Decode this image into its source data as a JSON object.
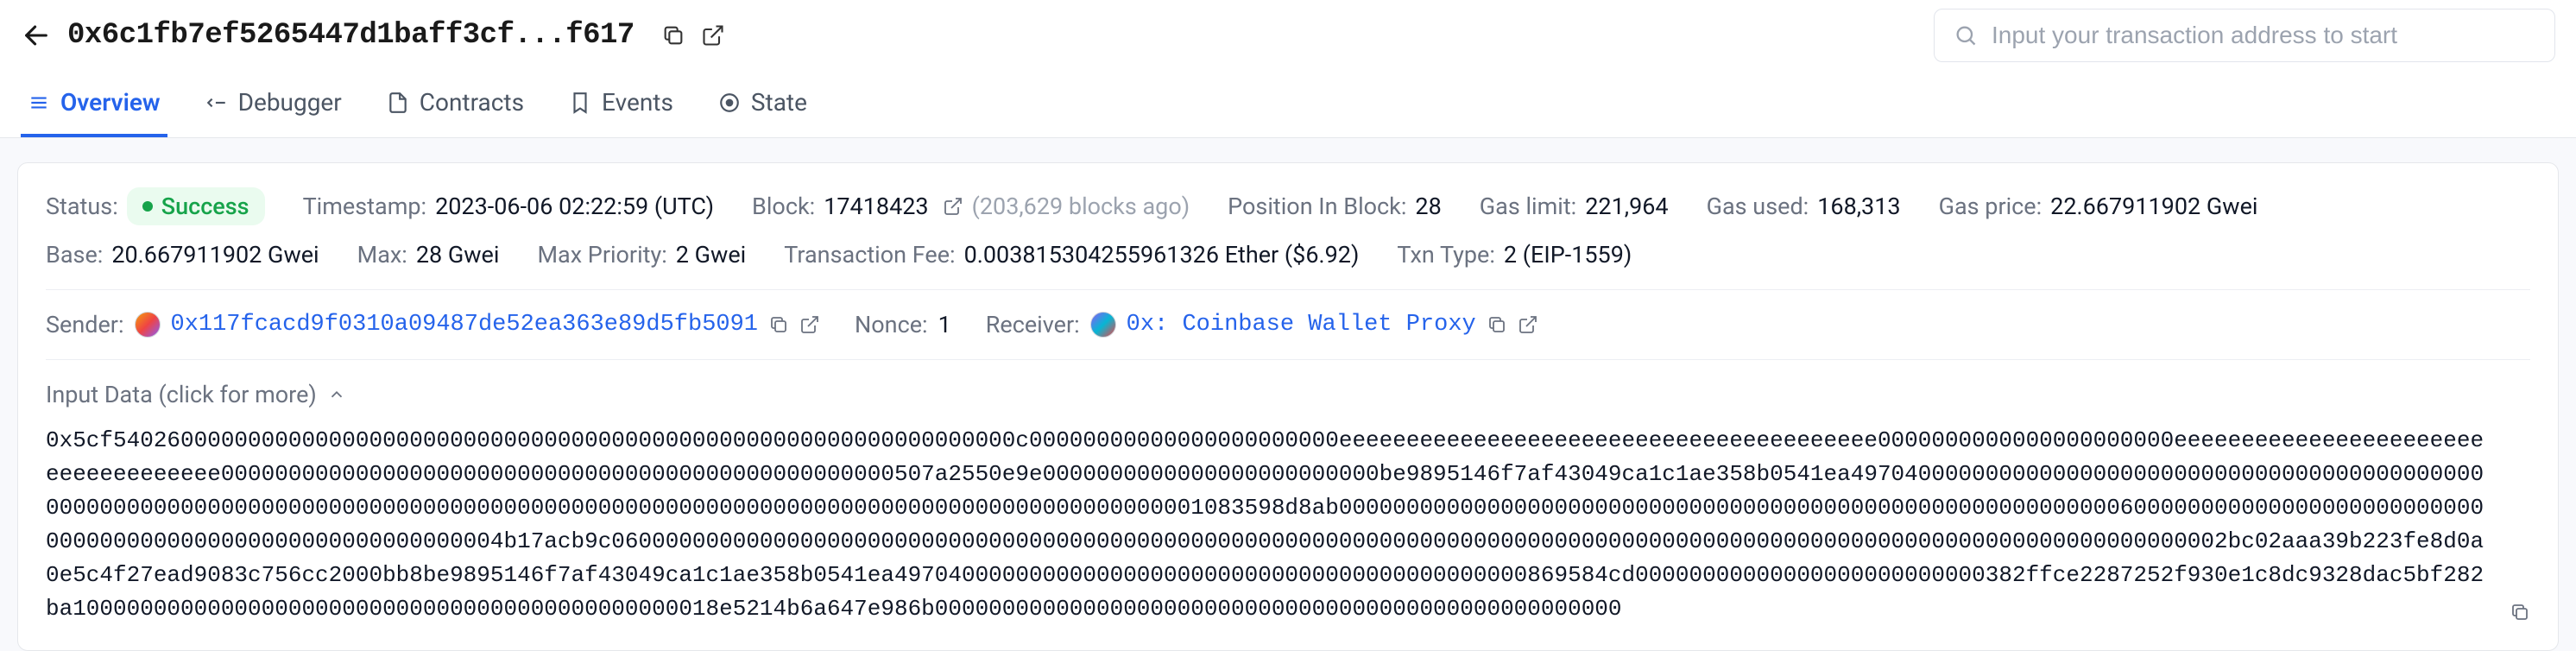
{
  "header": {
    "title": "0x6c1fb7ef5265447d1baff3cf...f617",
    "search_placeholder": "Input your transaction address to start"
  },
  "tabs": {
    "overview": "Overview",
    "debugger": "Debugger",
    "contracts": "Contracts",
    "events": "Events",
    "state": "State"
  },
  "meta": {
    "status_label": "Status:",
    "status_value": "Success",
    "timestamp_label": "Timestamp:",
    "timestamp_value": "2023-06-06 02:22:59 (UTC)",
    "block_label": "Block:",
    "block_value": "17418423",
    "blocks_ago": "(203,629 blocks ago)",
    "position_label": "Position In Block:",
    "position_value": "28",
    "gas_limit_label": "Gas limit:",
    "gas_limit_value": "221,964",
    "gas_used_label": "Gas used:",
    "gas_used_value": "168,313",
    "gas_price_label": "Gas price:",
    "gas_price_value": "22.667911902 Gwei",
    "base_label": "Base:",
    "base_value": "20.667911902 Gwei",
    "max_label": "Max:",
    "max_value": "28 Gwei",
    "max_priority_label": "Max Priority:",
    "max_priority_value": "2 Gwei",
    "txn_fee_label": "Transaction Fee:",
    "txn_fee_value": "0.003815304255961326 Ether ($6.92)",
    "txn_type_label": "Txn Type:",
    "txn_type_value": "2 (EIP-1559)"
  },
  "addr": {
    "sender_label": "Sender:",
    "sender_value": "0x117fcacd9f0310a09487de52ea363e89d5fb5091",
    "nonce_label": "Nonce:",
    "nonce_value": "1",
    "receiver_label": "Receiver:",
    "receiver_value": "0x: Coinbase Wallet Proxy"
  },
  "input": {
    "header": "Input Data (click for more)",
    "data": "0x5cf5402600000000000000000000000000000000000000000000000000000000000000c00000000000000000000000eeeeeeeeeeeeeeeeeeeeeeeeeeeeeeeeeeeeeeee0000000000000000000000eeeeeeeeeeeeeeeeeeeeeeeeeeeeeeeeeeee00000000000000000000000000000000000000000000000000507a2550e9e0000000000000000000000000be9895146f7af43049ca1c1ae358b0541ea4970400000000000000000000000000000000000000000000000000000000000000000000000000000000000000000000000000000000000000000000000000000001083598d8ab00000000000000000000000000000000000000000000000000000000006000000000000000000000000000000000000000000000000000000000004b17acb9c060000000000000000000000000000000000000000000000000000000000000000000000000000000000000000000000000000000000000000000002bc02aaa39b223fe8d0a0e5c4f27ead9083c756cc2000bb8be9895146f7af43049ca1c1ae358b0541ea49704000000000000000000000000000000000000000000869584cd00000000000000000000000000382ffce2287252f930e1c8dc9328dac5bf282ba100000000000000000000000000000000000000000000018e5214b6a647e986b000000000000000000000000000000000000000000000000000"
  }
}
